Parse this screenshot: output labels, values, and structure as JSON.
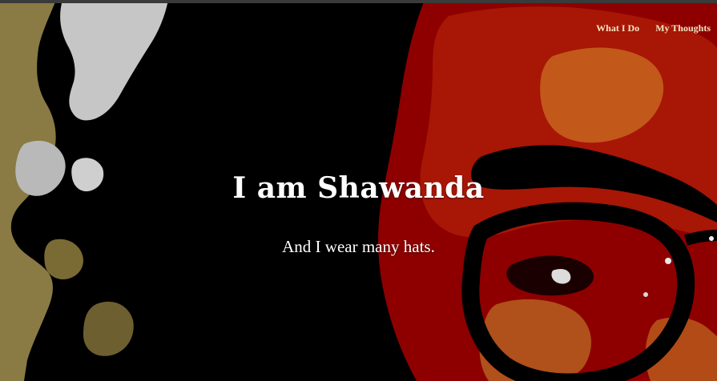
{
  "nav": {
    "items": [
      {
        "label": "What I Do"
      },
      {
        "label": "My Thoughts"
      }
    ]
  },
  "hero": {
    "title": "I am Shawanda",
    "subtitle": "And I wear many hats.",
    "background_image": "posterized-portrait-photo",
    "colors": {
      "background": "#000000",
      "deep_red": "#8e0000",
      "red": "#a81606",
      "orange": "#c2581a",
      "pale": "#c9c9c9",
      "olive": "#8a7a44",
      "nav_text": "#f4e6c2",
      "heading_text": "#ffffff"
    }
  }
}
